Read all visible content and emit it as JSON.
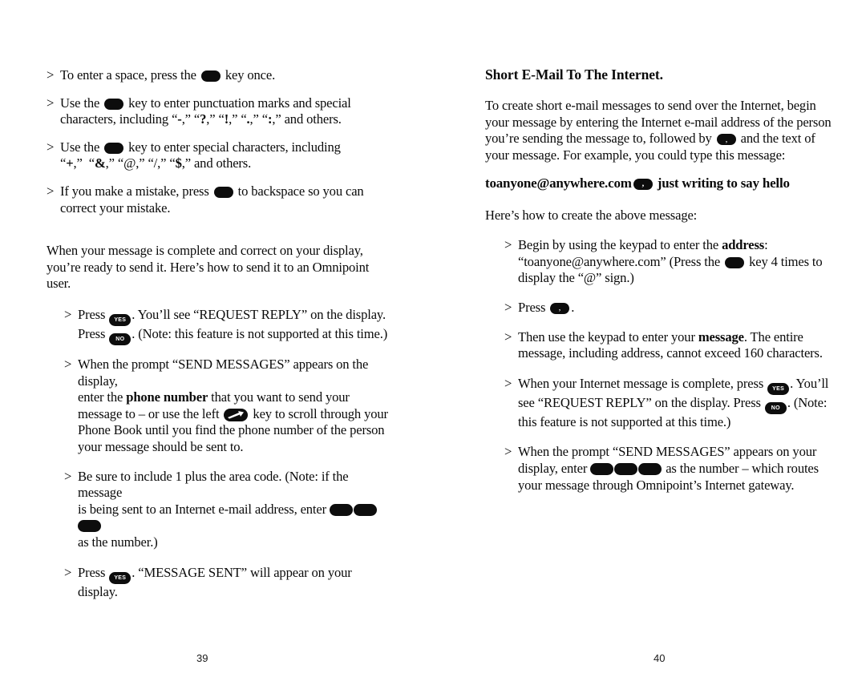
{
  "document": {
    "kind": "scanned-manual-spread"
  },
  "left_page": {
    "page_number": "39",
    "bullets_top": [
      {
        "marker": ">",
        "segments": [
          {
            "type": "text",
            "text": "To enter a space, press the "
          },
          {
            "type": "key",
            "style": "blank",
            "name": "blank-key-icon",
            "label": ""
          },
          {
            "type": "text",
            "text": " key once."
          }
        ],
        "plain": "To enter a space, press the [key] key once."
      },
      {
        "marker": ">",
        "plain": "Use the [key] key to enter punctuation marks and special characters, including “-,” “?,” “!,” “.,” “:,” and others.",
        "line1_pre": "Use the ",
        "line1_post": " key to enter punctuation marks and special",
        "line2_a": "characters, including “",
        "punct": [
          "-",
          "?",
          "!",
          ".",
          ":"
        ],
        "line2_b": " and others."
      },
      {
        "marker": ">",
        "plain": "Use the [key] key to enter special characters, including “+,” “&,” “@,” “/,” “$,” and others.",
        "line1_pre": "Use the ",
        "line1_post": " key to enter special characters, including",
        "chars": [
          "+",
          "&",
          "@",
          "/",
          "$"
        ],
        "line2_b": " and others."
      },
      {
        "marker": ">",
        "plain": "If you make a mistake, press [key] to backspace so you can correct your mistake.",
        "pre": "If you make a mistake, press ",
        "post": " to backspace so you can correct your mistake."
      }
    ],
    "paragraph": "When your message is complete and correct on your display, you’re ready to send it.  Here’s how to send it to an Omnipoint user.",
    "bullets_bottom": [
      {
        "marker": ">",
        "plain": "Press [YES].  You’ll see “REQUEST REPLY” on the display.  Press [NO].  (Note: this feature is not supported at this time.)",
        "a": "Press ",
        "yes": "YES",
        "b": ".  You’ll see “REQUEST REPLY” on the display.",
        "c": "Press ",
        "no": "NO",
        "d": ".  (Note: this feature is not supported at this time.)"
      },
      {
        "marker": ">",
        "plain": "When the prompt “SEND MESSAGES” appears on the display, enter the phone number that you want to send your message to – or use the left [scroll] key to scroll through your Phone Book until you find the phone number of the person your message should be sent to.",
        "a": "When the prompt “SEND MESSAGES” appears on the display,",
        "b": "enter the ",
        "bold": "phone number",
        "c": " that you want to send your",
        "d": "message to – or use the left ",
        "e": " key to scroll through your",
        "f": "Phone Book until you find the phone number of the person",
        "g": "your message should be sent to."
      },
      {
        "marker": ">",
        "plain": "Be sure to include 1 plus the area code.  (Note: if the message is being sent to an Internet e-mail address, enter [key][key][key] as the number.)",
        "a": "Be sure to include 1 plus the area code.  (Note: if the message",
        "b": "is being sent to an Internet e-mail address, enter ",
        "keys": 3,
        "c": "as the number.)"
      },
      {
        "marker": ">",
        "plain": "Press [YES].  “MESSAGE SENT” will appear on your display.",
        "a": "Press ",
        "yes": "YES",
        "b": ".  “MESSAGE SENT” will appear on your display."
      }
    ]
  },
  "right_page": {
    "page_number": "40",
    "heading": "Short E-Mail To The Internet.",
    "intro": {
      "plain": "To create short e-mail messages to send over the Internet, begin your message by entering the Internet e-mail address of the person you’re sending the message to, followed by [,] and the text of your message.  For example, you could type this message:",
      "a": "To create short e-mail messages to send over the Internet, begin your message by entering the Internet e-mail address of the person you’re sending the message to, followed by ",
      "b": " and the text of your message.  For example, you could type this message:"
    },
    "example": {
      "plain": "toanyone@anywhere.com [,] just writing to say hello",
      "address": "toanyone@anywhere.com",
      "suffix": "just writing to say hello"
    },
    "lead_in": "Here’s how to create the above message:",
    "bullets": [
      {
        "marker": ">",
        "plain": "Begin by using the keypad to enter the address: “toanyone@anywhere.com”  (Press the [key] key 4 times to display the “@” sign.)",
        "a": "Begin by using the keypad to enter the ",
        "bold": "address",
        "b": ":",
        "c": "“toanyone@anywhere.com”  (Press the ",
        "d": " key 4 times to",
        "e": "display the “@” sign.)"
      },
      {
        "marker": ">",
        "plain": "Press [,].",
        "a": "Press ",
        "b": "."
      },
      {
        "marker": ">",
        "plain": "Then use the keypad to enter your message.  The entire message, including address, cannot exceed 160 characters.",
        "a": "Then use the keypad to enter your ",
        "bold": "message",
        "b": ".  The entire",
        "c": "message, including address, cannot exceed 160 characters."
      },
      {
        "marker": ">",
        "plain": "When your Internet message is complete, press [YES].  You’ll see “REQUEST REPLY” on the display.  Press [NO].  (Note: this feature is not supported at this time.)",
        "a": "When your Internet message is complete, press ",
        "yes": "YES",
        "b": ".  You’ll",
        "c": "see “REQUEST REPLY” on the display.  Press ",
        "no": "NO",
        "d": ".  (Note:",
        "e": "this feature is not supported at this time.)"
      },
      {
        "marker": ">",
        "plain": "When the prompt “SEND MESSAGES” appears on your display, enter [key][key][key] as the number – which routes your message through Omnipoint’s Internet gateway.",
        "a": "When the prompt “SEND MESSAGES” appears on your",
        "b": "display, enter ",
        "keys": 3,
        "c": " as the number – which routes",
        "d": "your message through Omnipoint’s Internet gateway."
      }
    ]
  },
  "colors": {
    "ink": "#0a0a0a",
    "key_fill": "#0d0d0d",
    "key_text": "#ffffff",
    "paper": "#ffffff"
  }
}
